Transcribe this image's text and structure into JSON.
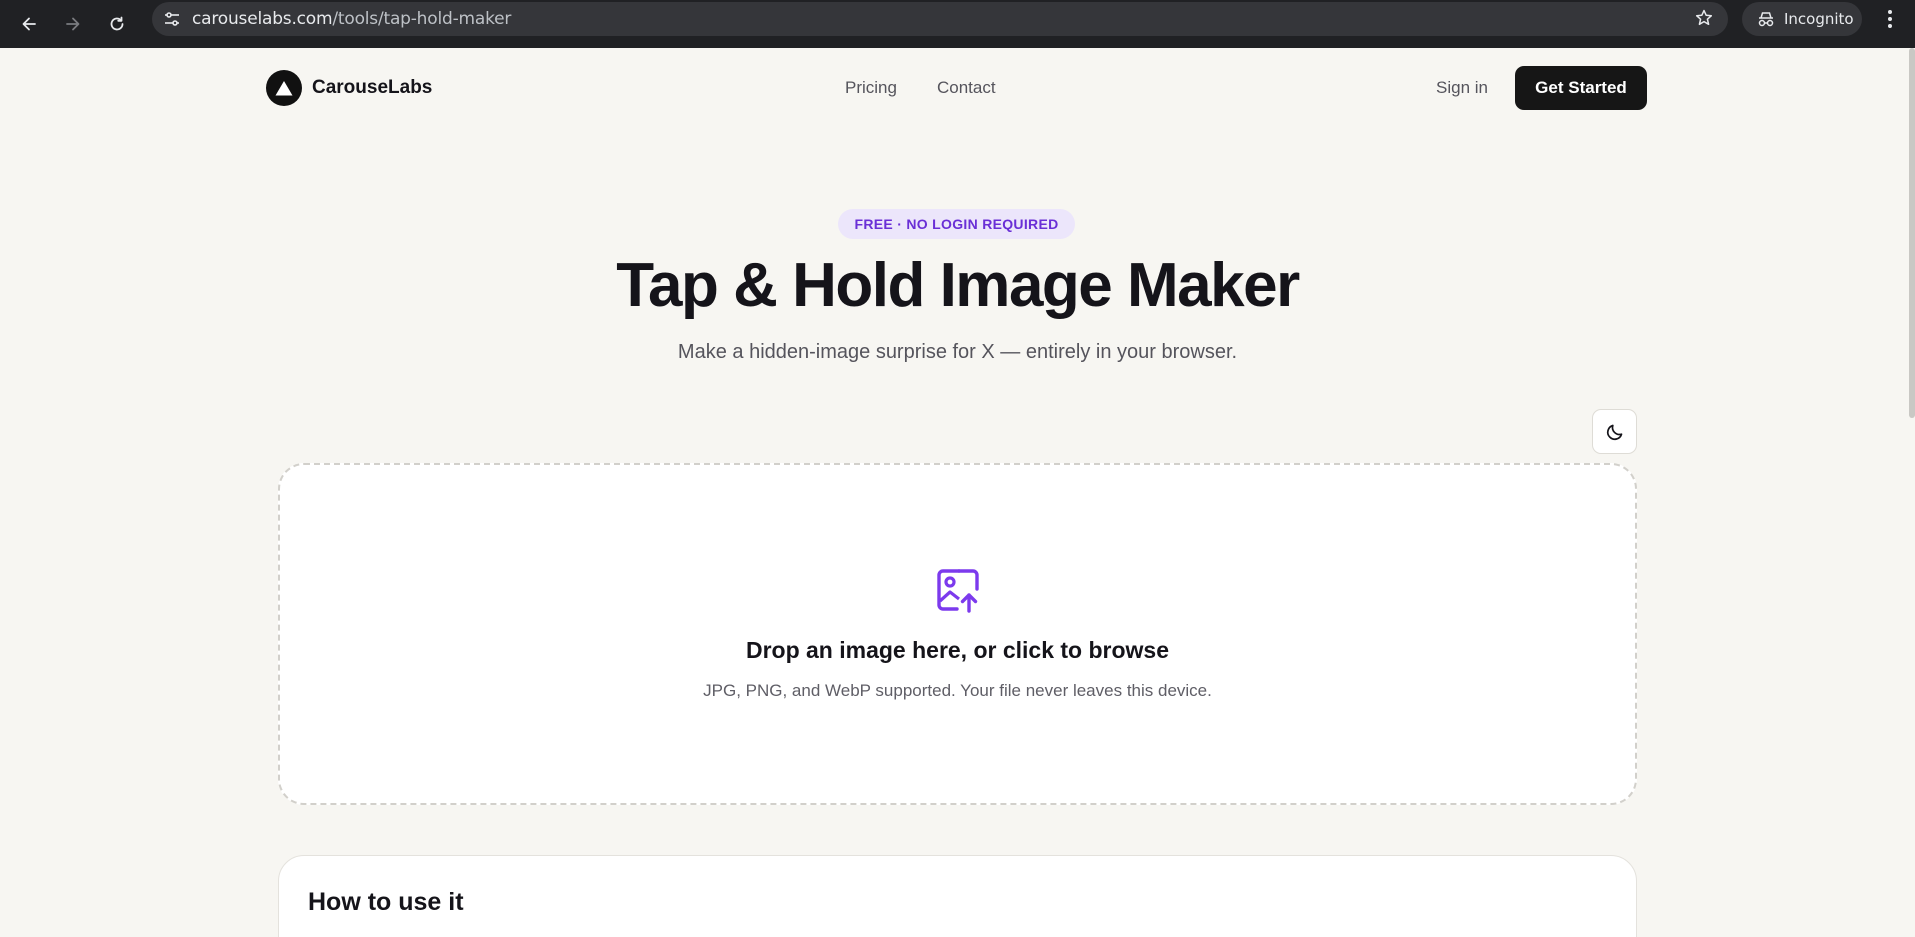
{
  "browser": {
    "url_domain": "carouselabs.com",
    "url_path": "/tools/tap-hold-maker",
    "incognito_label": "Incognito"
  },
  "site": {
    "brand": "CarouseLabs",
    "nav": [
      "Pricing",
      "Contact"
    ],
    "sign_in": "Sign in",
    "cta": "Get Started"
  },
  "hero": {
    "badge": "FREE · NO LOGIN REQUIRED",
    "title": "Tap & Hold Image Maker",
    "subtitle": "Make a hidden-image surprise for X — entirely in your browser."
  },
  "dropzone": {
    "title": "Drop an image here, or click to browse",
    "subtitle": "JPG, PNG, and WebP supported. Your file never leaves this device."
  },
  "howto": {
    "title": "How to use it"
  },
  "colors": {
    "accent": "#7c3aed",
    "badge_bg": "#ece6fb",
    "page_bg": "#f7f6f2",
    "cta_bg": "#161616"
  },
  "icons": {
    "back": "arrow-left-icon",
    "forward": "arrow-right-icon",
    "reload": "reload-icon",
    "site_info": "tune-icon",
    "bookmark": "star-icon",
    "incognito": "incognito-icon",
    "menu": "more-vertical-icon",
    "theme": "moon-icon",
    "upload": "image-upload-icon"
  }
}
